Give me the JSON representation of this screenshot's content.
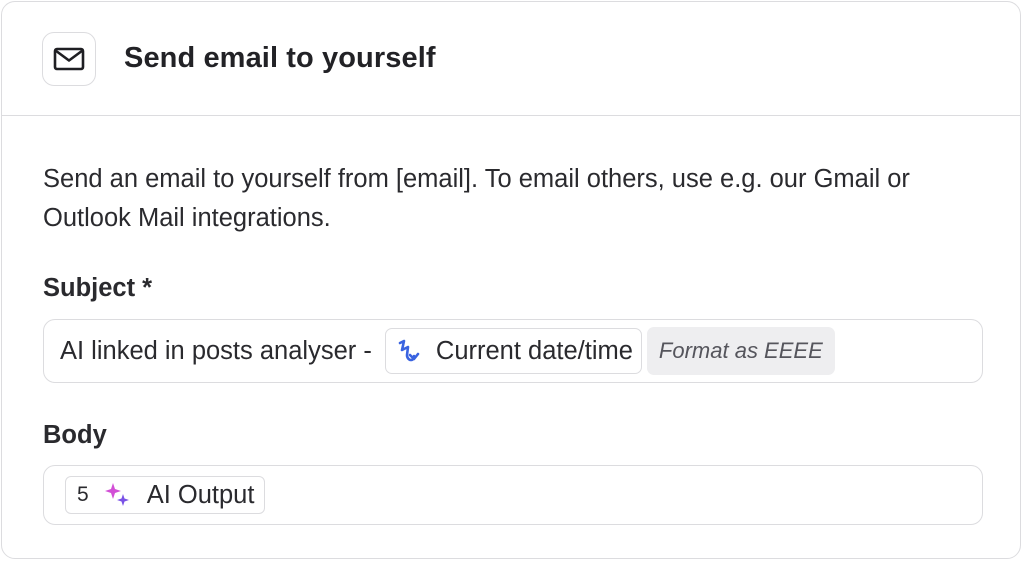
{
  "header": {
    "icon": "mail-icon",
    "title": "Send email to yourself"
  },
  "description": "Send an email to yourself from [email]. To email others, use e.g. our Gmail or Outlook Mail integrations.",
  "subject": {
    "label": "Subject *",
    "text": "AI linked in posts analyser - ",
    "variable_chip": {
      "icon": "date-time-icon",
      "label": "Current date/time",
      "icon_color": "#3a63e0"
    },
    "format_chip": "Format as EEEE"
  },
  "body": {
    "label": "Body",
    "variable_chip": {
      "step": "5",
      "icon": "ai-sparkle-icon",
      "label": "AI Output",
      "icon_colors": [
        "#d24fd6",
        "#7a52e6"
      ]
    }
  }
}
